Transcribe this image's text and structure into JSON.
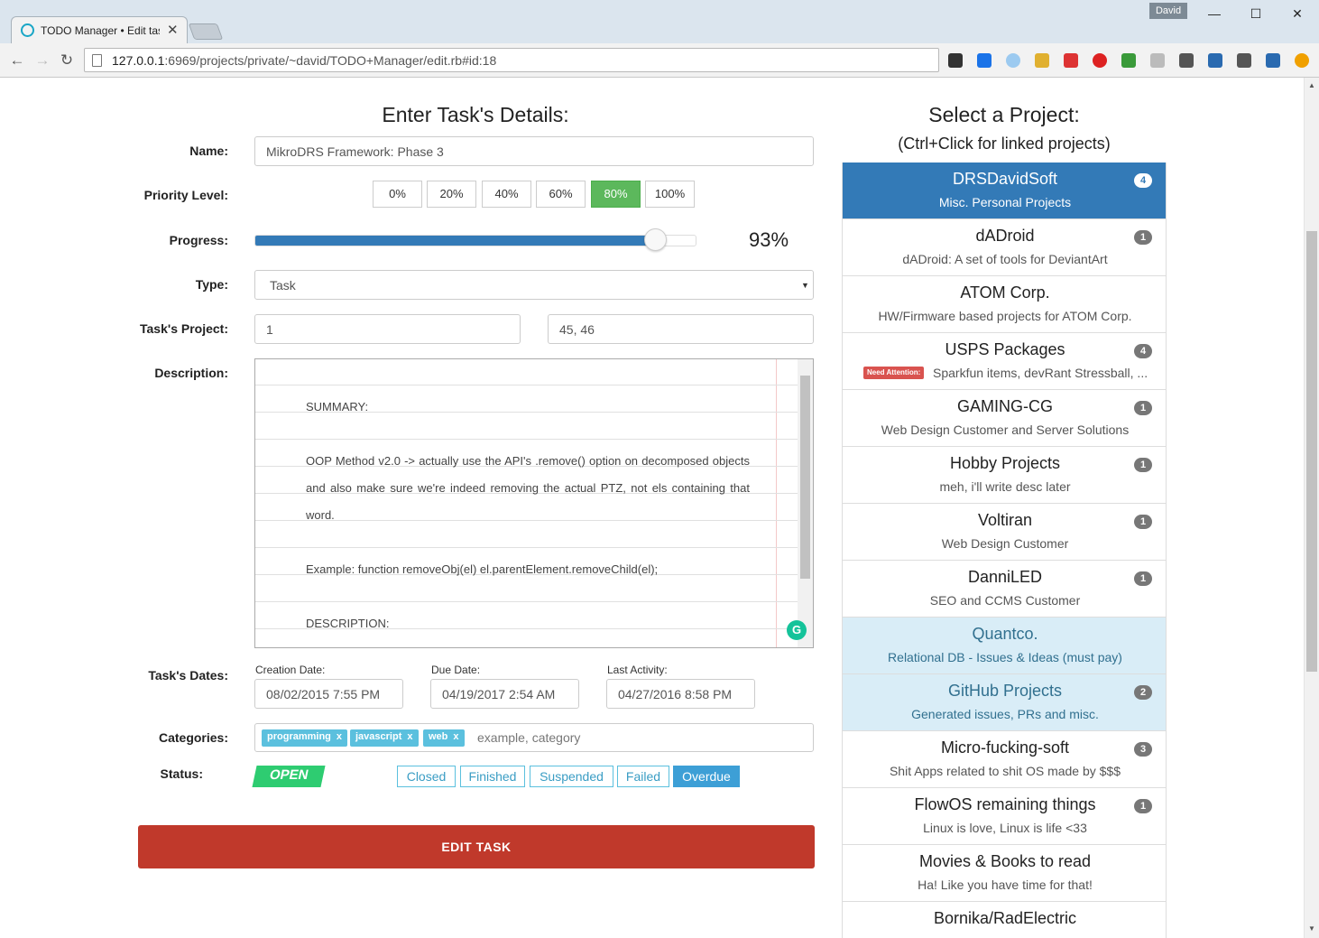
{
  "browser": {
    "tab_title": "TODO Manager • Edit task",
    "url_host": "127.0.0.1",
    "url_rest": ":6969/projects/private/~david/TODO+Manager/edit.rb#id:18",
    "user": "David",
    "minimize": "—",
    "maximize": "☐",
    "close": "✕",
    "back": "←",
    "forward": "→",
    "reload": "↻"
  },
  "form": {
    "heading": "Enter Task's Details:",
    "name_label": "Name:",
    "name_value": "MikroDRS Framework: Phase 3",
    "priority_label": "Priority Level:",
    "priority_options": [
      "0%",
      "20%",
      "40%",
      "60%",
      "80%",
      "100%"
    ],
    "priority_selected": "80%",
    "progress_label": "Progress:",
    "progress_value": "93%",
    "type_label": "Type:",
    "type_value": "Task",
    "project_label": "Task's Project:",
    "project_primary": "1",
    "project_linked": "45, 46",
    "description_label": "Description:",
    "description": {
      "summary": "SUMMARY:",
      "body": "OOP Method v2.0 -> actually use the API's .remove() option on decomposed objects and also make sure we're indeed removing the actual PTZ, not els containing that word.",
      "example": "Example: function removeObj(el) el.parentElement.removeChild(el);",
      "description": "DESCRIPTION:"
    },
    "dates_label": "Task's Dates:",
    "creation_label": "Creation Date:",
    "creation_value": "08/02/2015 7:55 PM",
    "due_label": "Due Date:",
    "due_value": "04/19/2017 2:54 AM",
    "activity_label": "Last Activity:",
    "activity_value": "04/27/2016 8:58 PM",
    "categories_label": "Categories:",
    "categories": [
      "programming",
      "javascript",
      "web"
    ],
    "tag_remove": "x",
    "categories_placeholder": "example, category",
    "status_label": "Status:",
    "status_current": "OPEN",
    "status_options": [
      "Closed",
      "Finished",
      "Suspended",
      "Failed",
      "Overdue"
    ],
    "status_selected": "Overdue",
    "submit_label": "EDIT TASK"
  },
  "projects": {
    "heading": "Select a Project:",
    "subheading": "(Ctrl+Click for linked projects)",
    "attention_label": "Need Attention:",
    "items": [
      {
        "name": "DRSDavidSoft",
        "desc": "Misc. Personal Projects",
        "badge": "4",
        "state": "active"
      },
      {
        "name": "dADroid",
        "desc": "dADroid: A set of tools for DeviantArt",
        "badge": "1",
        "state": ""
      },
      {
        "name": "ATOM Corp.",
        "desc": "HW/Firmware based projects for ATOM Corp.",
        "badge": "",
        "state": ""
      },
      {
        "name": "USPS Packages",
        "desc": "Sparkfun items, devRant Stressball, ...",
        "badge": "4",
        "state": "attention"
      },
      {
        "name": "GAMING-CG",
        "desc": "Web Design Customer and Server Solutions",
        "badge": "1",
        "state": ""
      },
      {
        "name": "Hobby Projects",
        "desc": "meh, i'll write desc later",
        "badge": "1",
        "state": ""
      },
      {
        "name": "Voltiran",
        "desc": "Web Design Customer",
        "badge": "1",
        "state": ""
      },
      {
        "name": "DanniLED",
        "desc": "SEO and CCMS Customer",
        "badge": "1",
        "state": ""
      },
      {
        "name": "Quantco.",
        "desc": "Relational DB - Issues & Ideas (must pay)",
        "badge": "",
        "state": "info"
      },
      {
        "name": "GitHub Projects",
        "desc": "Generated issues, PRs and misc.",
        "badge": "2",
        "state": "info"
      },
      {
        "name": "Micro-fucking-soft",
        "desc": "Shit Apps related to shit OS made by $$$",
        "badge": "3",
        "state": ""
      },
      {
        "name": "FlowOS remaining things",
        "desc": "Linux is love, Linux is life <33",
        "badge": "1",
        "state": ""
      },
      {
        "name": "Movies & Books to read",
        "desc": "Ha! Like you have time for that!",
        "badge": "",
        "state": ""
      },
      {
        "name": "Bornika/RadElectric",
        "desc": "",
        "badge": "",
        "state": ""
      }
    ]
  },
  "colors": {
    "primary": "#337ab7",
    "success": "#5cb85c",
    "danger": "#c0392b",
    "info": "#5bc0de",
    "open_status": "#2ecc71"
  },
  "progress_fraction": 0.91
}
